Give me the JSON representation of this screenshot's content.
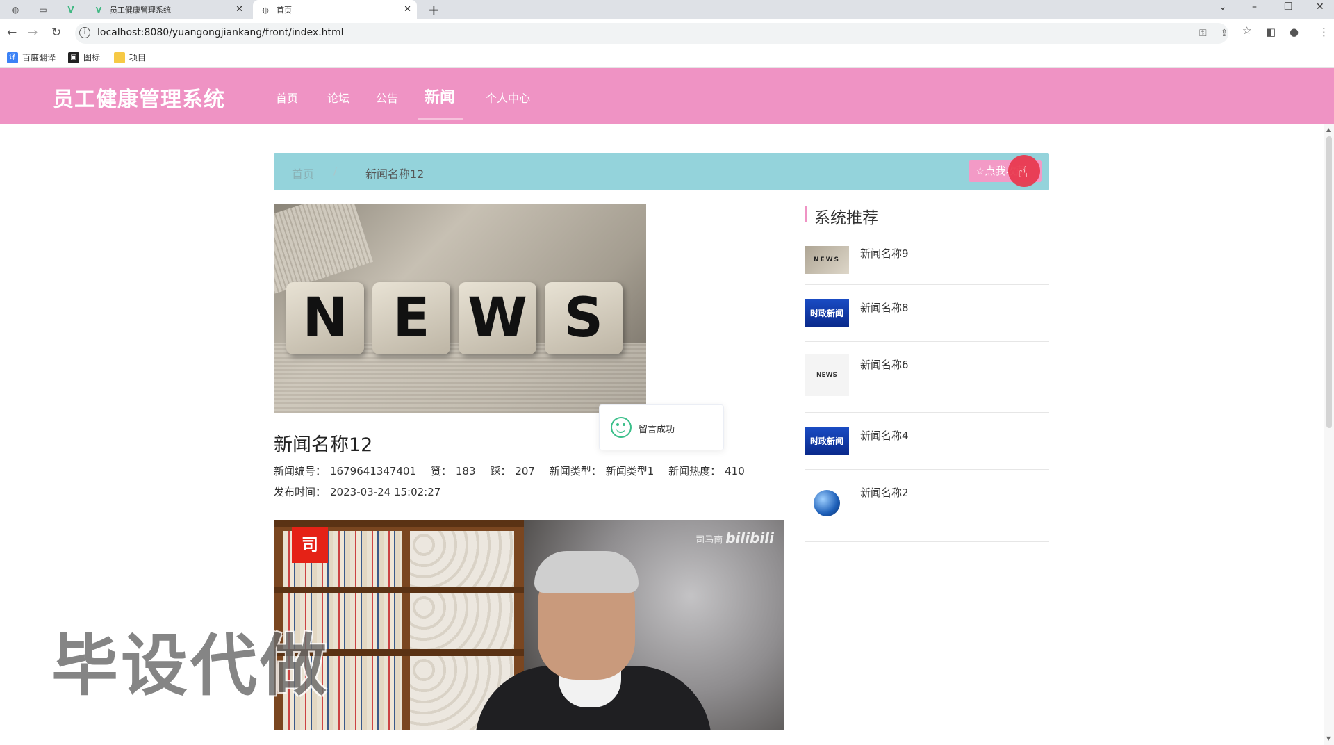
{
  "browser": {
    "tabs": [
      {
        "label": "员工健康管理系统"
      },
      {
        "label": "首页"
      }
    ],
    "url": "localhost:8080/yuangongjiankang/front/index.html",
    "bookmarks": [
      {
        "label": "百度翻译",
        "icon": "translate-icon"
      },
      {
        "label": "图标",
        "icon": "image-icon"
      },
      {
        "label": "项目",
        "icon": "folder-icon"
      }
    ]
  },
  "header": {
    "logo": "员工健康管理系统",
    "nav": [
      {
        "label": "首页"
      },
      {
        "label": "论坛"
      },
      {
        "label": "公告"
      },
      {
        "label": "新闻"
      },
      {
        "label": "个人中心"
      }
    ],
    "active_nav": "新闻",
    "bg_color": "#ef93c4"
  },
  "breadcrumb": {
    "home": "首页",
    "sep": "/",
    "current": "新闻名称12",
    "favorite_label": "☆点我收藏"
  },
  "article": {
    "image_text": [
      "N",
      "E",
      "W",
      "S"
    ],
    "title": "新闻名称12",
    "meta": {
      "id_label": "新闻编号：",
      "id_value": "1679641347401",
      "like_label": "赞：",
      "like_value": "183",
      "dislike_label": "踩：",
      "dislike_value": "207",
      "type_label": "新闻类型：",
      "type_value": "新闻类型1",
      "hot_label": "新闻热度：",
      "hot_value": "410",
      "time_label": "发布时间：",
      "time_value": "2023-03-24 15:02:27"
    },
    "video": {
      "badge": "司",
      "watermark_name": "司马南",
      "watermark_site": "bilibili"
    }
  },
  "toast": {
    "message": "留言成功"
  },
  "overlay_watermark": "毕设代做",
  "recommend": {
    "heading": "系统推荐",
    "items": [
      {
        "title": "新闻名称9",
        "thumb_text": "NEWS"
      },
      {
        "title": "新闻名称8",
        "thumb_text": "时政新闻"
      },
      {
        "title": "新闻名称6",
        "thumb_text": "NEWS"
      },
      {
        "title": "新闻名称4",
        "thumb_text": "时政新闻"
      },
      {
        "title": "新闻名称2",
        "thumb_text": ""
      }
    ]
  }
}
